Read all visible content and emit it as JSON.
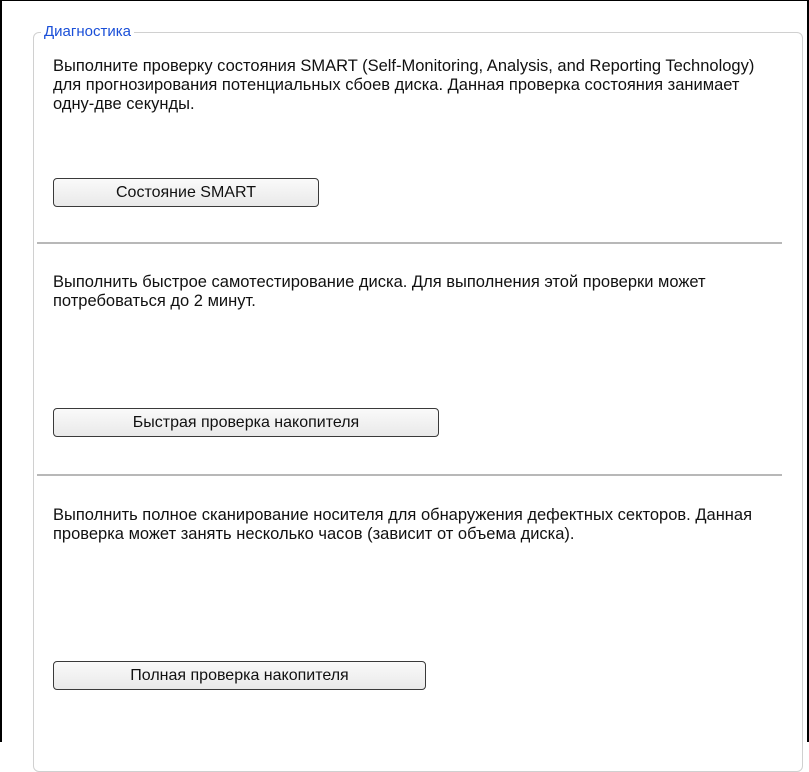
{
  "section": {
    "title": "Диагностика"
  },
  "smart": {
    "description": "Выполните проверку состояния SMART (Self-Monitoring, Analysis, and Reporting Technology) для прогнозирования потенциальных сбоев диска. Данная проверка состояния занимает одну-две секунды.",
    "button_label": "Состояние SMART"
  },
  "quick_test": {
    "description": "Выполнить быстрое самотестирование диска. Для выполнения этой проверки может потребоваться до 2 минут.",
    "button_label": "Быстрая проверка накопителя"
  },
  "full_test": {
    "description": "Выполнить полное сканирование носителя для обнаружения дефектных секторов. Данная проверка может занять несколько часов (зависит от объема диска).",
    "button_label": "Полная проверка накопителя"
  },
  "colors": {
    "legend": "#1a4fd8",
    "divider": "#b8b8b8",
    "fieldset_border": "#d0d0d0"
  }
}
